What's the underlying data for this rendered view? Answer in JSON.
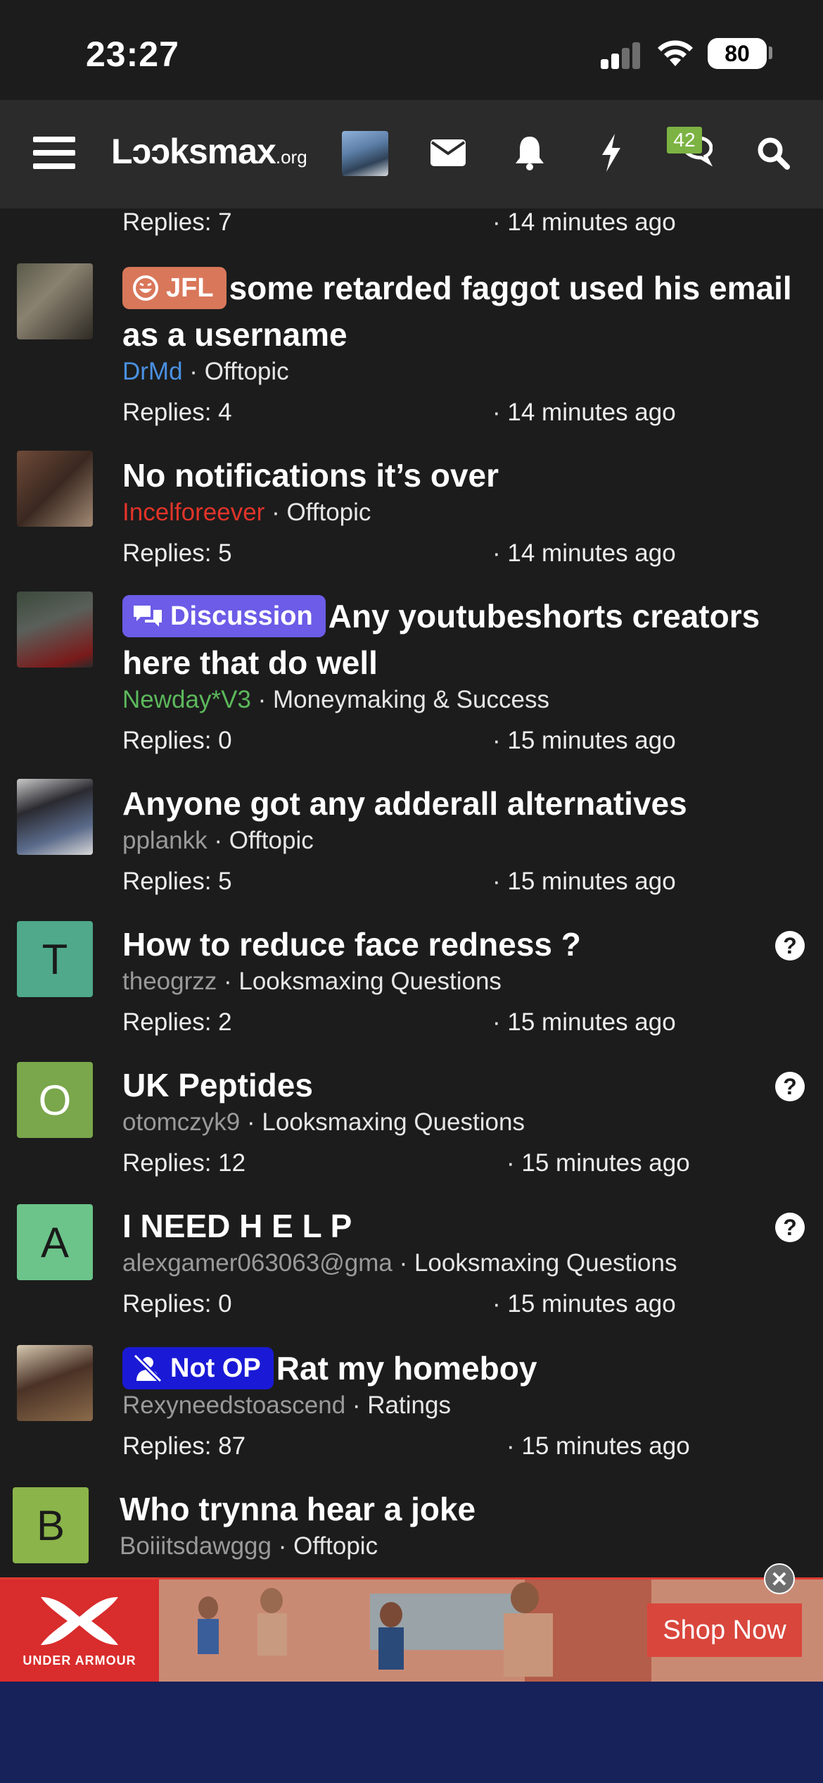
{
  "status_bar": {
    "time": "23:27",
    "battery": "80"
  },
  "nav": {
    "logo_main": "Lɔɔksmax",
    "logo_suffix": ".org",
    "chat_badge": "42"
  },
  "threads": [
    {
      "title": "",
      "author": "",
      "forum": "",
      "replies": "Replies: 7",
      "time": "· 14 minutes ago"
    },
    {
      "prefix": "JFL",
      "title": "some retarded faggot used his email as a username",
      "author": "DrMd",
      "forum": "Offtopic",
      "replies": "Replies: 4",
      "time": "· 14 minutes ago"
    },
    {
      "title": "No notifications it’s over",
      "author": "Incelforeever",
      "forum": "Offtopic",
      "replies": "Replies: 5",
      "time": "· 14 minutes ago"
    },
    {
      "prefix": "Discussion",
      "title": "Any youtubeshorts creators here that do well",
      "author": "Newday*V3",
      "forum": "Moneymaking & Success",
      "replies": "Replies: 0",
      "time": "· 15 minutes ago"
    },
    {
      "title": "Anyone got any adderall alternatives",
      "author": "pplankk",
      "forum": "Offtopic",
      "replies": "Replies: 5",
      "time": "· 15 minutes ago"
    },
    {
      "avatar_letter": "T",
      "title": "How to reduce face redness ?",
      "author": "theogrzz",
      "forum": "Looksmaxing Questions",
      "replies": "Replies: 2",
      "time": "· 15 minutes ago"
    },
    {
      "avatar_letter": "O",
      "title": "UK Peptides",
      "author": "otomczyk9",
      "forum": "Looksmaxing Questions",
      "replies": "Replies: 12",
      "time": "· 15 minutes ago"
    },
    {
      "avatar_letter": "A",
      "title": "I NEED H E L P",
      "author": "alexgamer063063@gma",
      "forum": "Looksmaxing Questions",
      "replies": "Replies: 0",
      "time": "· 15 minutes ago"
    },
    {
      "prefix": "Not OP",
      "title": "Rat my homeboy",
      "author": "Rexyneedstoascend",
      "forum": "Ratings",
      "replies": "Replies: 87",
      "time": "· 15 minutes ago"
    },
    {
      "avatar_letter": "B",
      "title": "Who trynna hear a joke",
      "author": "Boiiitsdawggg",
      "forum": "Offtopic"
    }
  ],
  "ad": {
    "brand": "UNDER ARMOUR",
    "button": "Shop Now",
    "close": "✕"
  },
  "colors": {
    "jfl_prefix": "#d9775a",
    "discussion_prefix": "#6c5ce7",
    "notop_prefix": "#1a1ad6",
    "author_blue": "#4a90e2",
    "author_red": "#e0342a",
    "author_green": "#5cb85c",
    "author_gray": "#9a9a9a"
  }
}
